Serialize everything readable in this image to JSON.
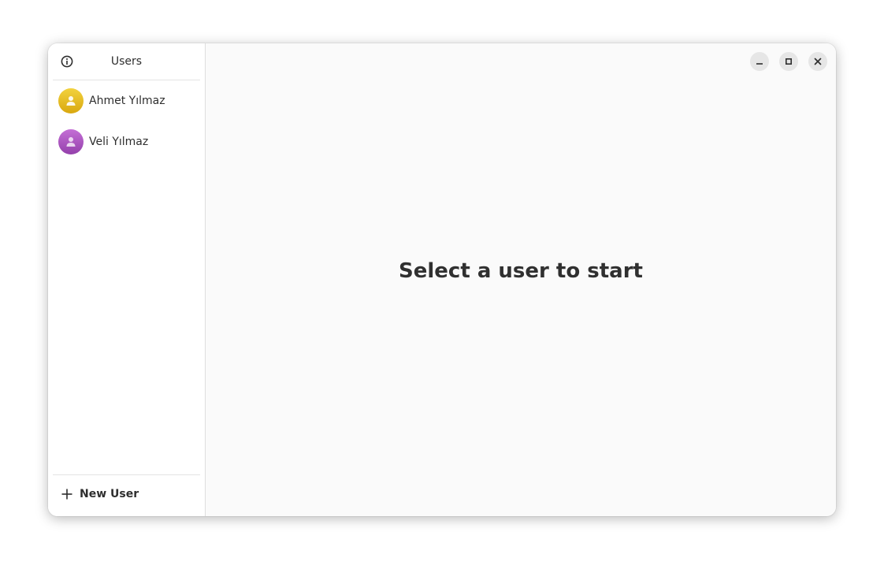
{
  "sidebar": {
    "title": "Users",
    "users": [
      {
        "name": "Ahmet Yılmaz",
        "avatar_color": "#e5b817"
      },
      {
        "name": "Veli Yılmaz",
        "avatar_color": "#a553bd"
      }
    ],
    "new_user_label": "New User"
  },
  "main": {
    "placeholder": "Select a user to start"
  },
  "window_controls": [
    "minimize",
    "maximize",
    "close"
  ]
}
